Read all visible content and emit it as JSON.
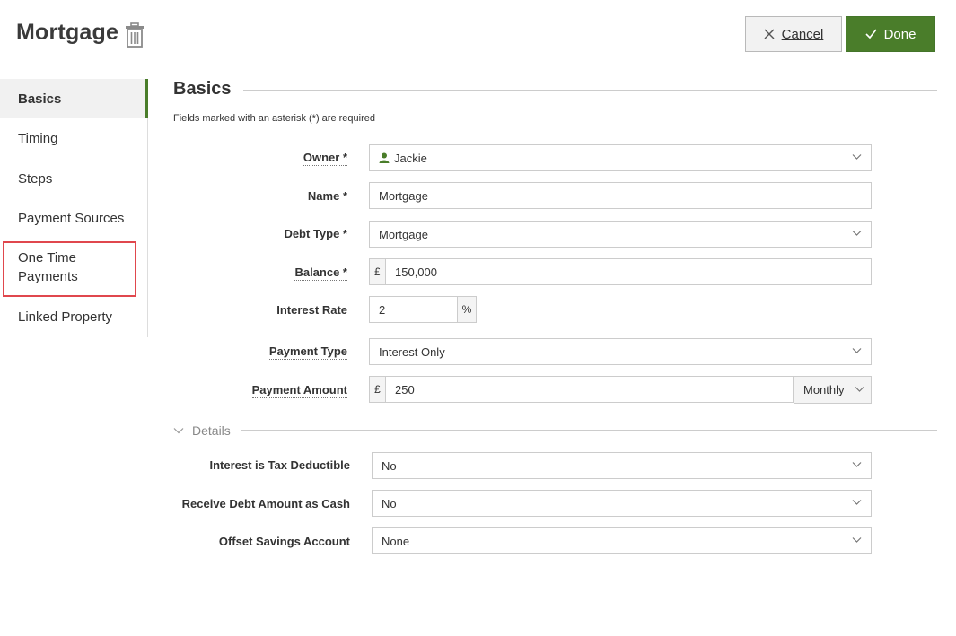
{
  "header": {
    "title": "Mortgage",
    "cancel_label": "Cancel",
    "done_label": "Done"
  },
  "sidebar": {
    "items": [
      {
        "label": "Basics",
        "active": true
      },
      {
        "label": "Timing"
      },
      {
        "label": "Steps"
      },
      {
        "label": "Payment Sources"
      },
      {
        "label": "One Time Payments"
      },
      {
        "label": "Linked Property"
      }
    ]
  },
  "basics": {
    "title": "Basics",
    "required_note": "Fields marked with an asterisk (*) are required",
    "owner": {
      "label": "Owner *",
      "value": "Jackie"
    },
    "name": {
      "label": "Name *",
      "value": "Mortgage"
    },
    "debt_type": {
      "label": "Debt Type *",
      "value": "Mortgage"
    },
    "balance": {
      "label": "Balance *",
      "currency": "£",
      "value": "150,000"
    },
    "interest_rate": {
      "label": "Interest Rate",
      "value": "2",
      "unit": "%"
    },
    "payment_type": {
      "label": "Payment Type",
      "value": "Interest Only"
    },
    "payment_amount": {
      "label": "Payment Amount",
      "currency": "£",
      "value": "250",
      "frequency": "Monthly"
    }
  },
  "details": {
    "title": "Details",
    "tax_deductible": {
      "label": "Interest is Tax Deductible",
      "value": "No"
    },
    "receive_cash": {
      "label": "Receive Debt Amount as Cash",
      "value": "No"
    },
    "offset_account": {
      "label": "Offset Savings Account",
      "value": "None"
    }
  },
  "colors": {
    "accent": "#4a7d2a",
    "highlight": "#e0474d"
  }
}
